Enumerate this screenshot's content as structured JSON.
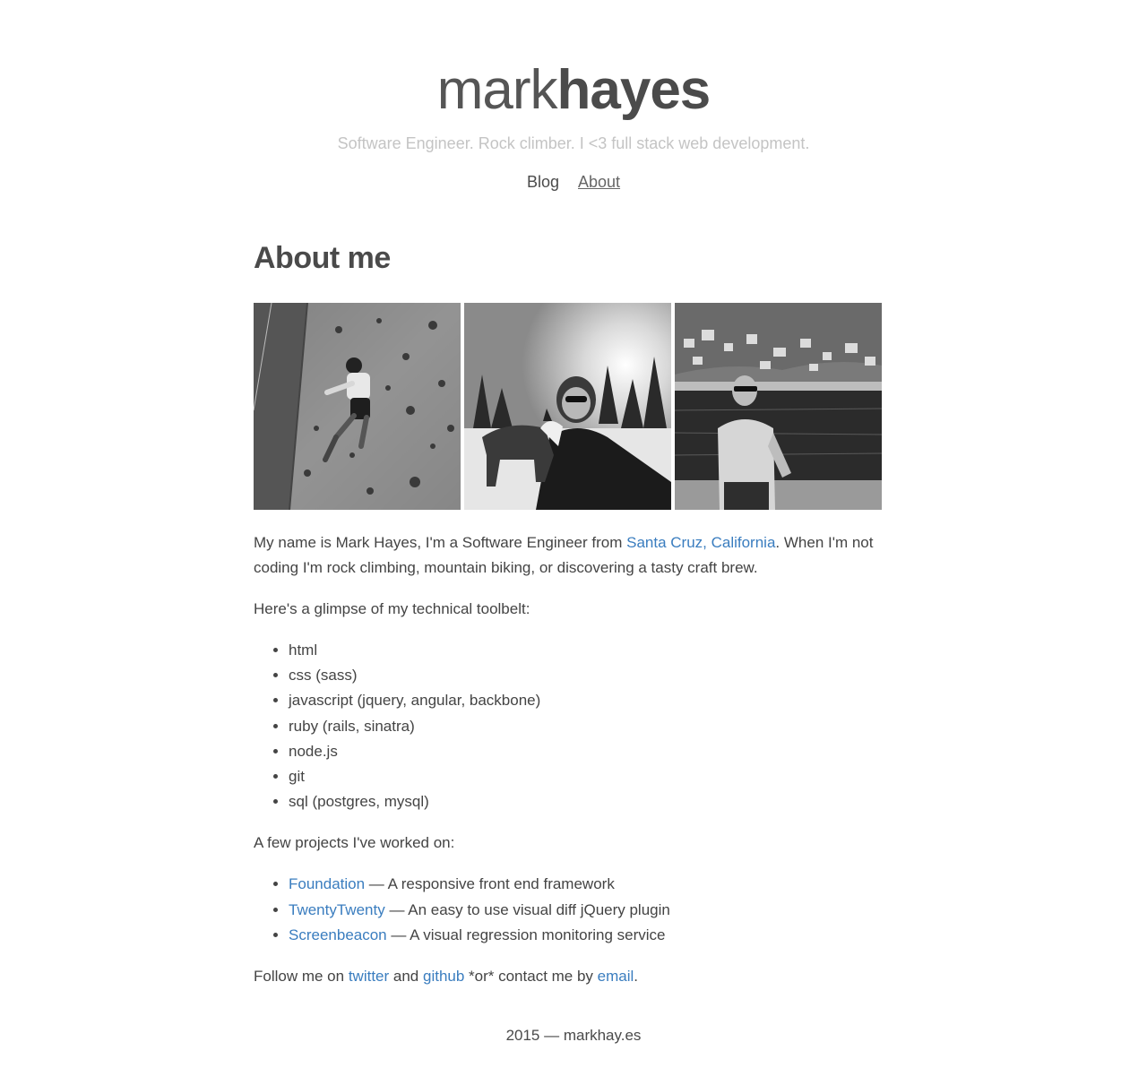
{
  "header": {
    "logo_light": "mark",
    "logo_bold": "hayes",
    "tagline": "Software Engineer. Rock climber. I <3 full stack web development."
  },
  "nav": {
    "items": [
      {
        "label": "Blog",
        "active": false
      },
      {
        "label": "About",
        "active": true
      }
    ]
  },
  "main": {
    "title": "About me",
    "photos": [
      {
        "subject": "climbing-wall-photo"
      },
      {
        "subject": "dog-selfie-snow-photo"
      },
      {
        "subject": "harbor-portrait-photo"
      }
    ],
    "intro": {
      "before": "My name is Mark Hayes, I'm a Software Engineer from ",
      "link": "Santa Cruz, California",
      "after": ". When I'm not coding I'm rock climbing, mountain biking, or discovering a tasty craft brew."
    },
    "toolbelt_intro": "Here's a glimpse of my technical toolbelt:",
    "toolbelt": [
      "html",
      "css (sass)",
      "javascript (jquery, angular, backbone)",
      "ruby (rails, sinatra)",
      "node.js",
      "git",
      "sql (postgres, mysql)"
    ],
    "projects_intro": "A few projects I've worked on:",
    "projects": [
      {
        "name": "Foundation",
        "desc": " — A responsive front end framework"
      },
      {
        "name": "TwentyTwenty",
        "desc": " — An easy to use visual diff jQuery plugin"
      },
      {
        "name": "Screenbeacon",
        "desc": " — A visual regression monitoring service"
      }
    ],
    "follow": {
      "prefix": "Follow me on ",
      "twitter": "twitter",
      "and": " and ",
      "github": "github",
      "middle": " *or* contact me by ",
      "email": "email",
      "suffix": "."
    }
  },
  "footer": {
    "text": "2015 — markhay.es"
  },
  "colors": {
    "link": "#3a7dbf",
    "text": "#444444",
    "tagline": "#c4c4c4"
  }
}
